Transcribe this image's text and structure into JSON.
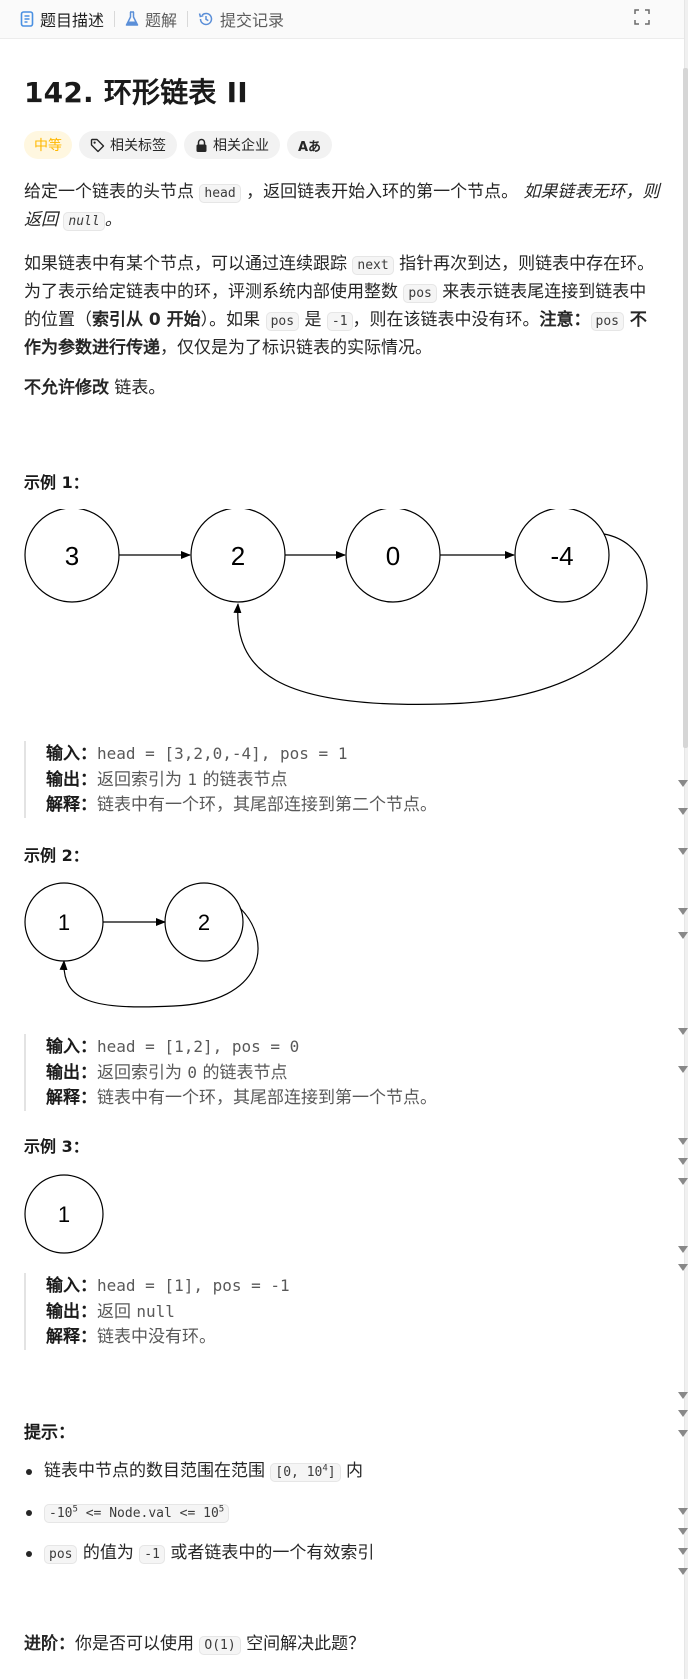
{
  "tabs": [
    {
      "label": "题目描述",
      "icon": "description-icon",
      "active": true
    },
    {
      "label": "题解",
      "icon": "flask-icon",
      "active": false
    },
    {
      "label": "提交记录",
      "icon": "history-icon",
      "active": false
    }
  ],
  "problem": {
    "title": "142. 环形链表 II",
    "difficulty": "中等",
    "tags": {
      "related_tags": "相关标签",
      "related_companies": "相关企业",
      "translate": "Aあ"
    },
    "p1": {
      "t1": "给定一个链表的头节点 ",
      "c1": "head",
      "t2": " ，返回链表开始入环的第一个节点。 ",
      "em1": "如果链表无环，则返回 ",
      "c2": "null",
      "t3": "。"
    },
    "p2": {
      "t1": "如果链表中有某个节点，可以通过连续跟踪 ",
      "c1": "next",
      "t2": " 指针再次到达，则链表中存在环。 为了表示给定链表中的环，评测系统内部使用整数 ",
      "c2": "pos",
      "t3": " 来表示链表尾连接到链表中的位置（",
      "b1": "索引从 0 开始",
      "t4": "）。如果 ",
      "c3": "pos",
      "t5": " 是 ",
      "c4": "-1",
      "t6": "，则在该链表中没有环。",
      "b2": "注意：",
      "c5": "pos",
      "b3": " 不作为参数进行传递",
      "t7": "，仅仅是为了标识链表的实际情况。"
    },
    "p3": {
      "b1": "不允许修改",
      "t1": " 链表。"
    }
  },
  "examples": [
    {
      "title": "示例 1：",
      "nodes": [
        "3",
        "2",
        "0",
        "-4"
      ],
      "input_label": "输入：",
      "input": "head = [3,2,0,-4], pos = 1",
      "output_label": "输出：",
      "output_pre": "返回索引为 ",
      "output_mono": "1",
      "output_post": " 的链表节点",
      "explain_label": "解释：",
      "explain": "链表中有一个环，其尾部连接到第二个节点。"
    },
    {
      "title": "示例 2：",
      "nodes": [
        "1",
        "2"
      ],
      "input_label": "输入：",
      "input": "head = [1,2], pos = 0",
      "output_label": "输出：",
      "output_pre": "返回索引为 ",
      "output_mono": "0",
      "output_post": " 的链表节点",
      "explain_label": "解释：",
      "explain": "链表中有一个环，其尾部连接到第一个节点。"
    },
    {
      "title": "示例 3：",
      "nodes": [
        "1"
      ],
      "input_label": "输入：",
      "input": "head = [1], pos = -1",
      "output_label": "输出：",
      "output_pre": "返回 ",
      "output_mono": "null",
      "output_post": "",
      "explain_label": "解释：",
      "explain": "链表中没有环。"
    }
  ],
  "hints": {
    "title": "提示：",
    "h1": {
      "pre": "链表中节点的数目范围在范围 ",
      "code_a": "[0, 10",
      "sup": "4",
      "code_b": "]",
      "post": " 内"
    },
    "h2": {
      "code_a": "-10",
      "sup1": "5",
      "code_b": " <= Node.val <= 10",
      "sup2": "5"
    },
    "h3": {
      "c1": "pos",
      "t1": " 的值为 ",
      "c2": "-1",
      "t2": " 或者链表中的一个有效索引"
    }
  },
  "advanced": {
    "label": "进阶：",
    "pre": "你是否可以使用 ",
    "code": "O(1)",
    "post": " 空间解决此题？"
  },
  "colors": {
    "difficulty": "#ffb800",
    "accent_blue": "#4a90e2"
  }
}
